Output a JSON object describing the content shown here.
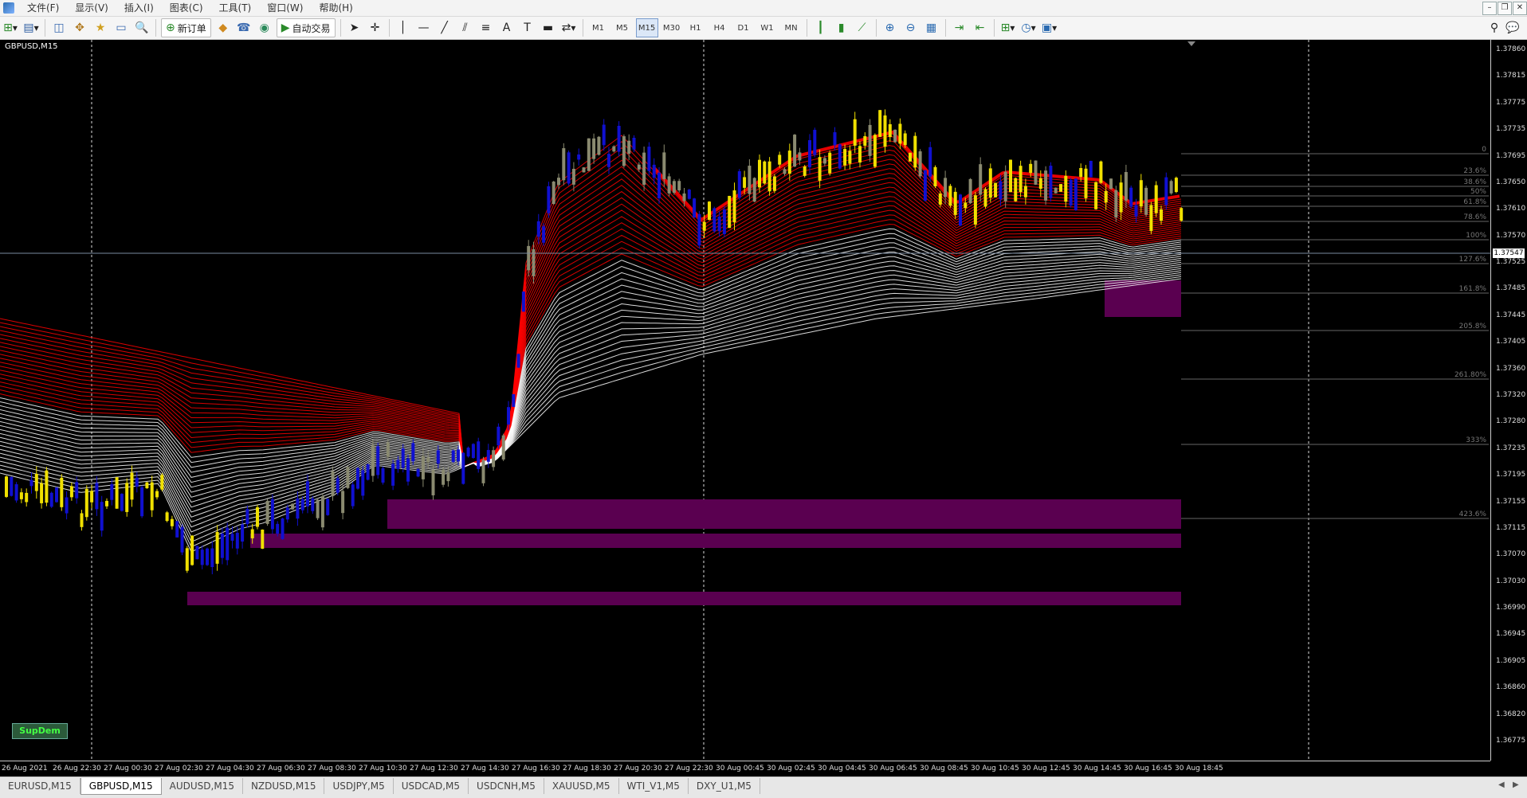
{
  "menu": {
    "items": [
      "文件(F)",
      "显示(V)",
      "插入(I)",
      "图表(C)",
      "工具(T)",
      "窗口(W)",
      "帮助(H)"
    ]
  },
  "toolbar": {
    "new_order_label": "新订单",
    "auto_trade_label": "自动交易",
    "timeframes": [
      "M1",
      "M5",
      "M15",
      "M30",
      "H1",
      "H4",
      "D1",
      "W1",
      "MN"
    ],
    "active_timeframe": "M15"
  },
  "chart": {
    "title": "GBPUSD,M15",
    "indicator_label": "SupDem",
    "current_price": "1.37547",
    "price_labels": [
      "1.37860",
      "1.37815",
      "1.37775",
      "1.37735",
      "1.37695",
      "1.37650",
      "1.37610",
      "1.37570",
      "1.37525",
      "1.37485",
      "1.37445",
      "1.37405",
      "1.37360",
      "1.37320",
      "1.37280",
      "1.37235",
      "1.37195",
      "1.37155",
      "1.37115",
      "1.37070",
      "1.37030",
      "1.36990",
      "1.36945",
      "1.36905",
      "1.36860",
      "1.36820",
      "1.36775"
    ],
    "time_labels": [
      "26 Aug 2021",
      "26 Aug 22:30",
      "27 Aug 00:30",
      "27 Aug 02:30",
      "27 Aug 04:30",
      "27 Aug 06:30",
      "27 Aug 08:30",
      "27 Aug 10:30",
      "27 Aug 12:30",
      "27 Aug 14:30",
      "27 Aug 16:30",
      "27 Aug 18:30",
      "27 Aug 20:30",
      "27 Aug 22:30",
      "30 Aug 00:45",
      "30 Aug 02:45",
      "30 Aug 04:45",
      "30 Aug 06:45",
      "30 Aug 08:45",
      "30 Aug 10:45",
      "30 Aug 12:45",
      "30 Aug 14:45",
      "30 Aug 16:45",
      "30 Aug 18:45"
    ],
    "fib_levels": [
      "0",
      "23.6%",
      "38.6%",
      "50%",
      "61.8%",
      "78.6%",
      "100%",
      "127.6%",
      "161.8%",
      "205.8%",
      "261.80%",
      "333%",
      "423.6%"
    ],
    "colors": {
      "background": "#000000",
      "ribbon_bear": "#ff0000",
      "ribbon_bull": "#ffffff",
      "candle_blue": "#1010d0",
      "candle_yellow": "#f0e000",
      "candle_gray": "#8a8a70",
      "zone": "#5a0050"
    }
  },
  "tabs": {
    "items": [
      "EURUSD,M15",
      "GBPUSD,M15",
      "AUDUSD,M15",
      "NZDUSD,M15",
      "USDJPY,M5",
      "USDCAD,M5",
      "USDCNH,M5",
      "XAUUSD,M5",
      "WTI_V1,M5",
      "DXY_U1,M5"
    ],
    "active": "GBPUSD,M15"
  }
}
